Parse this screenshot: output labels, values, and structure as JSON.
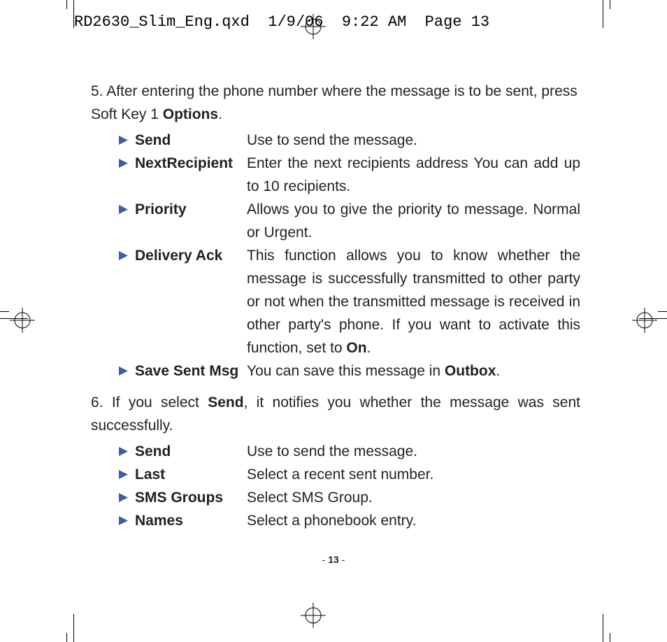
{
  "slug": "RD2630_Slim_Eng.qxd  1/9/06  9:22 AM  Page 13",
  "step5_lead": "5. After entering the phone number where the message is to be sent, press Soft Key 1 ",
  "step5_keyword": "Options",
  "step5_tail": ".",
  "opts5": [
    {
      "label": "Send",
      "desc_plain": "Use to send the message."
    },
    {
      "label": "NextRecipient",
      "desc_plain": "Enter the next recipients address You can add up to 10 recipients."
    },
    {
      "label": "Priority",
      "desc_plain": "Allows you to give the priority to message. Normal or Urgent."
    },
    {
      "label": "Delivery Ack",
      "desc_pre": "This function allows you to know whether the message is successfully transmitted to other party or not when the transmitted message is received in other party's phone. If you want to activate this function, set to ",
      "desc_bold": "On",
      "desc_post": "."
    },
    {
      "label": "Save Sent Msg",
      "desc_pre": "You can save this message in ",
      "desc_bold": "Outbox",
      "desc_post": "."
    }
  ],
  "step6_pre": "6. If you select ",
  "step6_bold": "Send",
  "step6_post": ", it notifies you whether the message was sent successfully.",
  "opts6": [
    {
      "label": "Send",
      "desc_plain": "Use to send the message."
    },
    {
      "label": "Last",
      "desc_plain": "Select a recent sent number."
    },
    {
      "label": "SMS Groups",
      "desc_plain": "Select SMS Group."
    },
    {
      "label": "Names",
      "desc_plain": "Select a phonebook entry."
    }
  ],
  "page_number": "13",
  "triangle_color": "#3a5ea8"
}
